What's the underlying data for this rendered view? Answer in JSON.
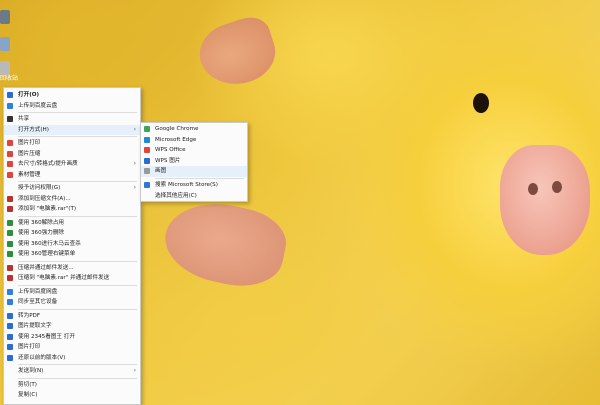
{
  "desktop": {
    "icon_label": "回收站"
  },
  "main_menu": [
    {
      "label": "打开(O)",
      "icon": "app-icon",
      "color": "#2b6cd4",
      "bold": true
    },
    {
      "label": "上传到百度云盘",
      "icon": "cloud-upload-icon",
      "color": "#2f7fe0"
    },
    {
      "sep": true
    },
    {
      "label": "共享",
      "icon": "share-icon",
      "color": "#333333"
    },
    {
      "label": "打开方式(H)",
      "arrow": true,
      "highlight": true
    },
    {
      "sep": true
    },
    {
      "label": "图片打印",
      "icon": "wps-w-icon",
      "color": "#e0453c"
    },
    {
      "label": "图片压缩",
      "icon": "wps-w-icon",
      "color": "#e0453c"
    },
    {
      "label": "去尺寸/转格式/提升画质",
      "icon": "wps-w-icon",
      "color": "#e0453c",
      "arrow": true
    },
    {
      "label": "素材管理",
      "icon": "wps-w-icon",
      "color": "#e0453c"
    },
    {
      "sep": true
    },
    {
      "label": "授予访问权限(G)",
      "arrow": true
    },
    {
      "label": "添加到压缩文件(A)...",
      "icon": "archive-icon",
      "color": "#b8332a"
    },
    {
      "label": "添加到 \"电脑素.rar\"(T)",
      "icon": "archive-icon",
      "color": "#b8332a"
    },
    {
      "sep": true
    },
    {
      "label": "使用 360解除占用",
      "icon": "shield-360-icon",
      "color": "#2d8f3a"
    },
    {
      "label": "使用 360强力删除",
      "icon": "shield-360-icon",
      "color": "#2d8f3a"
    },
    {
      "label": "使用 360进行木马云查杀",
      "icon": "shield-360-icon",
      "color": "#2d8f3a"
    },
    {
      "label": "使用 360管理右键菜单",
      "icon": "shield-360-icon",
      "color": "#2d8f3a"
    },
    {
      "sep": true
    },
    {
      "label": "压缩并通过邮件发送...",
      "icon": "archive-icon",
      "color": "#b8332a"
    },
    {
      "label": "压缩到 \"电脑素.rar\" 并通过邮件发送",
      "icon": "archive-icon",
      "color": "#b8332a"
    },
    {
      "sep": true
    },
    {
      "label": "上传到百度网盘",
      "icon": "cloud-icon",
      "color": "#2f7fe0"
    },
    {
      "label": "同步至其它设备",
      "icon": "sync-icon",
      "color": "#2f7fe0"
    },
    {
      "sep": true
    },
    {
      "label": "转为PDF",
      "icon": "pdf-icon",
      "color": "#2b6cd4"
    },
    {
      "label": "图片提取文字",
      "icon": "text-extract-icon",
      "color": "#2b6cd4"
    },
    {
      "label": "使用 2345看图王 打开",
      "icon": "viewer-icon",
      "color": "#2b6cd4"
    },
    {
      "label": "图片打印",
      "icon": "print-icon",
      "color": "#2b6cd4"
    },
    {
      "label": "还原以前的版本(V)",
      "icon": "restore-icon",
      "color": "#2b6cd4"
    },
    {
      "sep": true
    },
    {
      "label": "发送到(N)",
      "arrow": true
    },
    {
      "sep": true
    },
    {
      "label": "剪切(T)"
    },
    {
      "label": "复制(C)"
    }
  ],
  "sub_menu": [
    {
      "label": "Google Chrome",
      "icon": "chrome-icon",
      "color": "#3ba55c"
    },
    {
      "label": "Microsoft Edge",
      "icon": "edge-icon",
      "color": "#1f8bd6"
    },
    {
      "label": "WPS Office",
      "icon": "wps-icon",
      "color": "#e0453c"
    },
    {
      "label": "WPS 图片",
      "icon": "wps-image-icon",
      "color": "#2b6cd4"
    },
    {
      "label": "画图",
      "icon": "paint-icon",
      "color": "#9a9a9a",
      "highlight": true
    },
    {
      "sep": true
    },
    {
      "label": "搜索 Microsoft Store(S)",
      "icon": "store-icon",
      "color": "#2b7ad4"
    },
    {
      "label": "选择其他应用(C)"
    }
  ]
}
